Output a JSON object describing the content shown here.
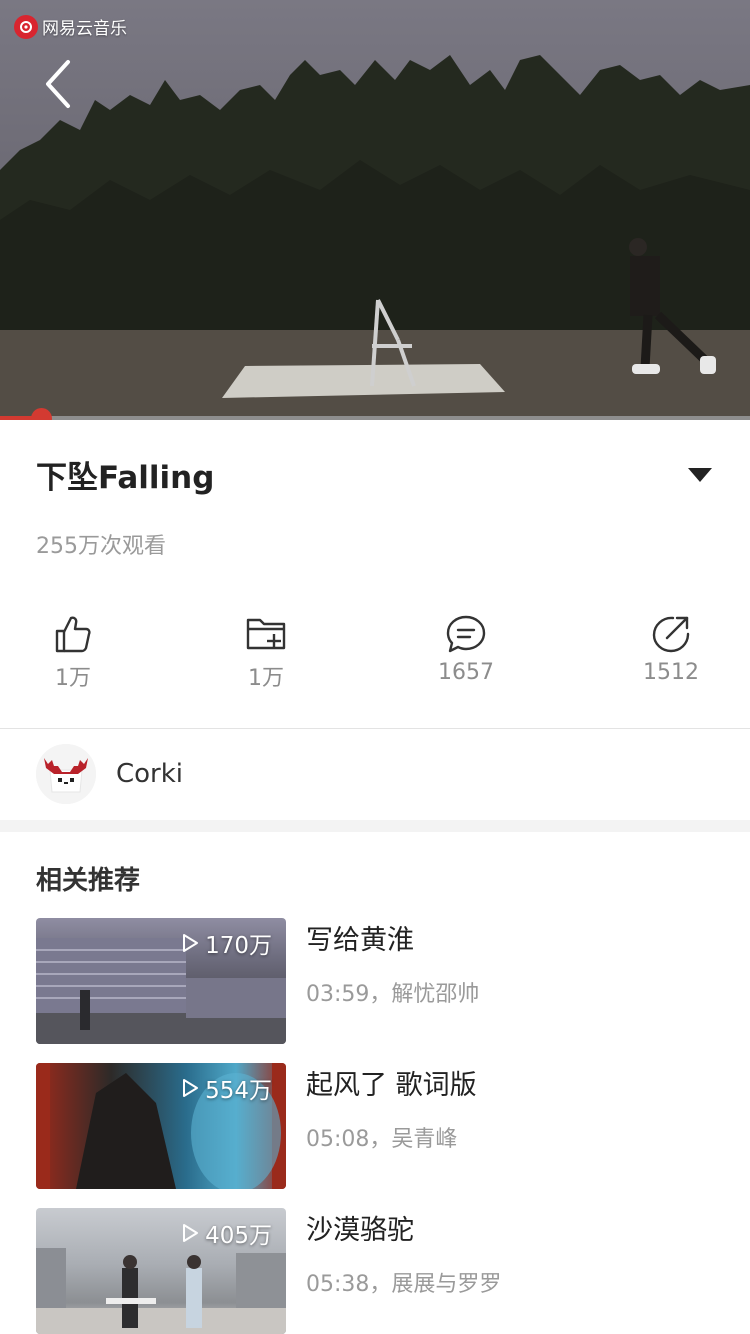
{
  "app": {
    "watermark": "网易云音乐",
    "brand_color": "#d33a31"
  },
  "player": {
    "progress_fraction": 0.055
  },
  "video": {
    "title": "下坠Falling",
    "views": "255万次观看"
  },
  "actions": [
    {
      "icon": "thumbs-up-icon",
      "count": "1万"
    },
    {
      "icon": "folder-add-icon",
      "count": "1万"
    },
    {
      "icon": "comment-icon",
      "count": "1657"
    },
    {
      "icon": "share-icon",
      "count": "1512"
    }
  ],
  "author": {
    "name": "Corki"
  },
  "recommend": {
    "heading": "相关推荐",
    "items": [
      {
        "title": "写给黄淮",
        "meta": "03:59，解忧邵帅",
        "plays": "170万"
      },
      {
        "title": "起风了 歌词版",
        "meta": "05:08，吴青峰",
        "plays": "554万"
      },
      {
        "title": "沙漠骆驼",
        "meta": "05:38，展展与罗罗",
        "plays": "405万"
      }
    ]
  }
}
